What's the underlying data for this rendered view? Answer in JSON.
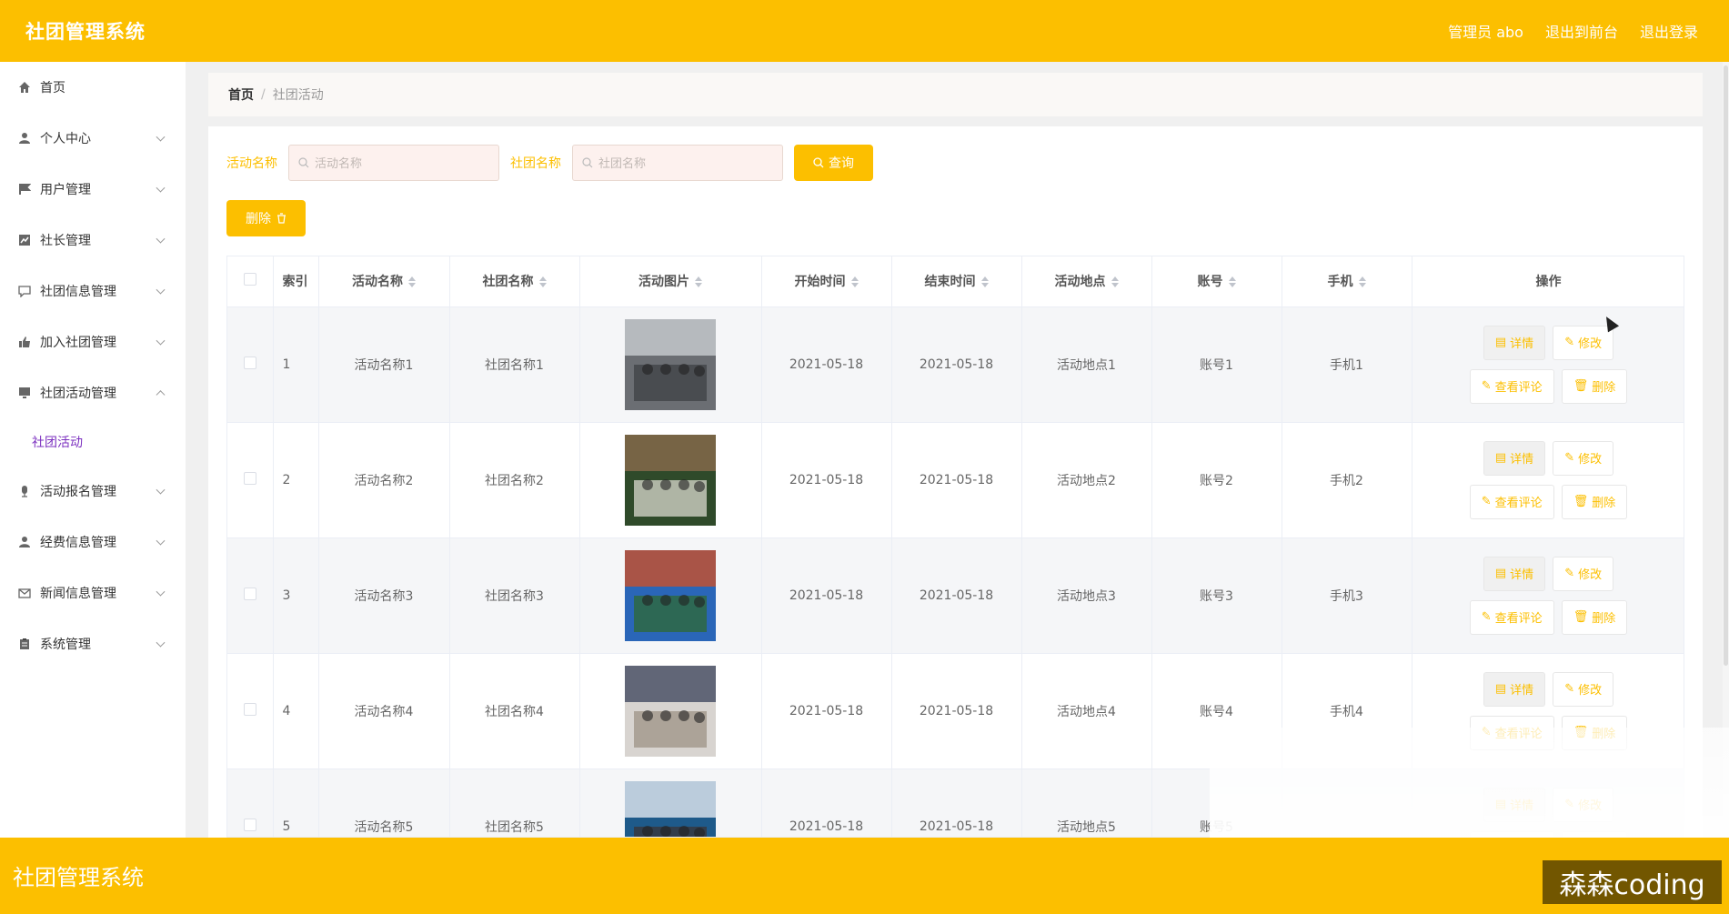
{
  "header": {
    "brand": "社团管理系统",
    "admin": "管理员 abo",
    "to_front": "退出到前台",
    "logout": "退出登录"
  },
  "sidebar": {
    "items": [
      {
        "label": "首页",
        "icon": "home-icon",
        "expandable": false
      },
      {
        "label": "个人中心",
        "icon": "user-icon",
        "expandable": true
      },
      {
        "label": "用户管理",
        "icon": "flag-icon",
        "expandable": true
      },
      {
        "label": "社长管理",
        "icon": "chart-icon",
        "expandable": true
      },
      {
        "label": "社团信息管理",
        "icon": "chat-icon",
        "expandable": true
      },
      {
        "label": "加入社团管理",
        "icon": "thumb-icon",
        "expandable": true
      },
      {
        "label": "社团活动管理",
        "icon": "monitor-icon",
        "expandable": true,
        "expanded": true
      },
      {
        "label": "活动报名管理",
        "icon": "mic-icon",
        "expandable": true
      },
      {
        "label": "经费信息管理",
        "icon": "person-icon",
        "expandable": true
      },
      {
        "label": "新闻信息管理",
        "icon": "mail-icon",
        "expandable": true
      },
      {
        "label": "系统管理",
        "icon": "clipboard-icon",
        "expandable": true
      }
    ],
    "sub_active": "社团活动"
  },
  "breadcrumb": {
    "home": "首页",
    "current": "社团活动"
  },
  "search": {
    "label1": "活动名称",
    "placeholder1": "活动名称",
    "label2": "社团名称",
    "placeholder2": "社团名称",
    "query": "查询"
  },
  "delete_label": "删除",
  "table": {
    "headers": {
      "index": "索引",
      "name": "活动名称",
      "club": "社团名称",
      "pic": "活动图片",
      "start": "开始时间",
      "end": "结束时间",
      "place": "活动地点",
      "account": "账号",
      "phone": "手机",
      "ops": "操作"
    },
    "rows": [
      {
        "index": "1",
        "name": "活动名称1",
        "club": "社团名称1",
        "start": "2021-05-18",
        "end": "2021-05-18",
        "place": "活动地点1",
        "account": "账号1",
        "phone": "手机1"
      },
      {
        "index": "2",
        "name": "活动名称2",
        "club": "社团名称2",
        "start": "2021-05-18",
        "end": "2021-05-18",
        "place": "活动地点2",
        "account": "账号2",
        "phone": "手机2"
      },
      {
        "index": "3",
        "name": "活动名称3",
        "club": "社团名称3",
        "start": "2021-05-18",
        "end": "2021-05-18",
        "place": "活动地点3",
        "account": "账号3",
        "phone": "手机3"
      },
      {
        "index": "4",
        "name": "活动名称4",
        "club": "社团名称4",
        "start": "2021-05-18",
        "end": "2021-05-18",
        "place": "活动地点4",
        "account": "账号4",
        "phone": "手机4"
      },
      {
        "index": "5",
        "name": "活动名称5",
        "club": "社团名称5",
        "start": "2021-05-18",
        "end": "2021-05-18",
        "place": "活动地点5",
        "account": "账号5",
        "phone": ""
      }
    ],
    "ops": {
      "detail": "详情",
      "edit": "修改",
      "comments": "查看评论",
      "delete": "删除"
    }
  },
  "footer": {
    "brand": "社团管理系统"
  },
  "watermark": "森森coding",
  "colors": {
    "accent": "#fcbf00",
    "sub_active": "#7b2fbf"
  }
}
